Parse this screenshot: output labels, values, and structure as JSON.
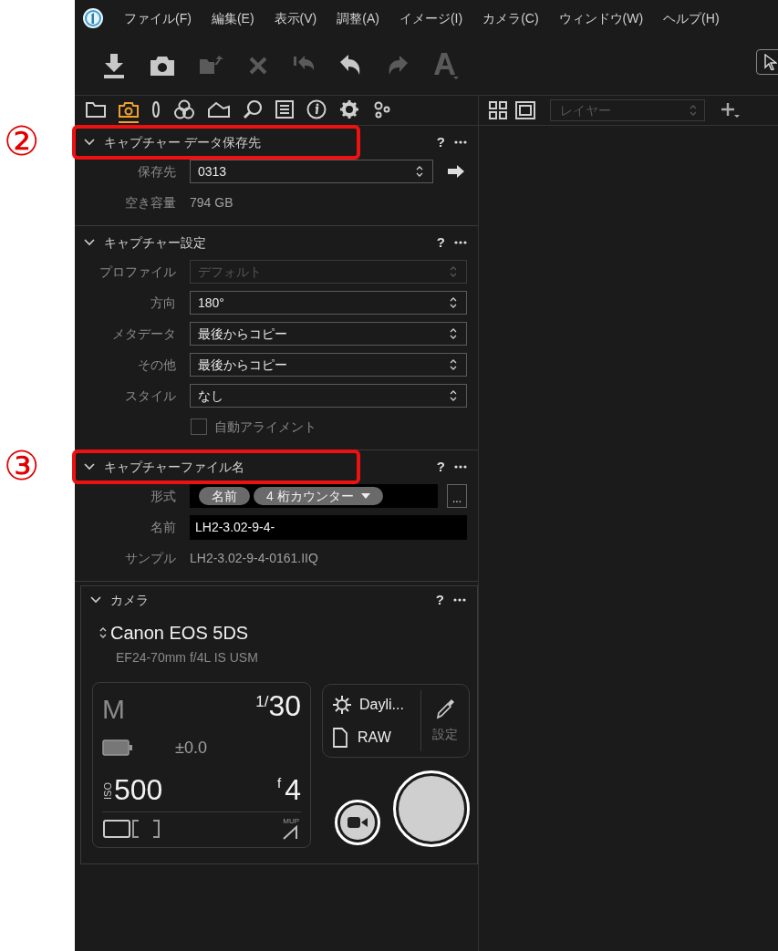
{
  "menu_bar": {
    "items": [
      "ファイル(F)",
      "編集(E)",
      "表示(V)",
      "調整(A)",
      "イメージ(I)",
      "カメラ(C)",
      "ウィンドウ(W)",
      "ヘルプ(H)"
    ]
  },
  "toolbar": [
    {
      "kind": "import",
      "disabled": false
    },
    {
      "kind": "capture",
      "disabled": false
    },
    {
      "kind": "move",
      "disabled": true
    },
    {
      "kind": "delete",
      "disabled": true
    },
    {
      "kind": "reset",
      "disabled": true
    },
    {
      "kind": "undo",
      "disabled": false
    },
    {
      "kind": "redo",
      "disabled": true
    },
    {
      "kind": "text",
      "disabled": true
    }
  ],
  "tool_tabs": [
    {
      "kind": "folder",
      "selected": false
    },
    {
      "kind": "camera",
      "selected": true
    },
    {
      "kind": "lens",
      "selected": false
    },
    {
      "kind": "color",
      "selected": false
    },
    {
      "kind": "exposure",
      "selected": false
    },
    {
      "kind": "search",
      "selected": false
    },
    {
      "kind": "list",
      "selected": false
    },
    {
      "kind": "info",
      "selected": false
    },
    {
      "kind": "gear",
      "selected": false
    },
    {
      "kind": "gears",
      "selected": false
    }
  ],
  "viewer_toolbar": {
    "layer_placeholder": "レイヤー"
  },
  "sections": [
    {
      "kind": "fields",
      "title": "キャプチャー データ保存先",
      "help": "?",
      "expanded": true,
      "highlighted": true,
      "callout": "②",
      "rows": [
        {
          "kind": "select",
          "label": "保存先",
          "value": "0313",
          "disabled": false,
          "action": true
        },
        {
          "kind": "info",
          "label": "空き容量",
          "value": "794 GB"
        }
      ]
    },
    {
      "kind": "fields",
      "title": "キャプチャー設定",
      "help": "?",
      "expanded": true,
      "highlighted": false,
      "rows": [
        {
          "kind": "select",
          "label": "プロファイル",
          "value": "デフォルト",
          "disabled": true,
          "action": false
        },
        {
          "kind": "select",
          "label": "方向",
          "value": "180°",
          "disabled": false,
          "action": false
        },
        {
          "kind": "select",
          "label": "メタデータ",
          "value": "最後からコピー",
          "disabled": false,
          "action": false
        },
        {
          "kind": "select",
          "label": "その他",
          "value": "最後からコピー",
          "disabled": false,
          "action": false
        },
        {
          "kind": "select",
          "label": "スタイル",
          "value": "なし",
          "disabled": false,
          "action": false
        },
        {
          "kind": "checkbox",
          "label": "自動アライメント",
          "checked": false
        }
      ]
    },
    {
      "kind": "fields",
      "title": "キャプチャーファイル名",
      "help": "?",
      "expanded": true,
      "highlighted": true,
      "callout": "③",
      "rows": [
        {
          "kind": "tokens",
          "label": "形式",
          "tokens": [
            {
              "text": "名前",
              "dropdown": false
            },
            {
              "text": "4 桁カウンター",
              "dropdown": true
            }
          ],
          "more": "..."
        },
        {
          "kind": "text",
          "label": "名前",
          "value": "LH2-3.02-9-4-"
        },
        {
          "kind": "info",
          "label": "サンプル",
          "value": "LH2-3.02-9-4-0161.IIQ"
        }
      ]
    },
    {
      "kind": "camera",
      "title": "カメラ",
      "help": "?",
      "expanded": true,
      "highlighted": false,
      "camera": {
        "name": "Canon EOS 5DS",
        "lens": "EF24-70mm f/4L IS USM",
        "mode": "M",
        "shutter_numerator": "1/",
        "shutter": "30",
        "exposure_comp": "±0.0",
        "iso_label": "ISO",
        "iso": "500",
        "aperture_prefix": "f",
        "aperture": "4",
        "mup": "MUP",
        "white_balance": "Dayli...",
        "format": "RAW",
        "settings": "設定"
      }
    }
  ]
}
